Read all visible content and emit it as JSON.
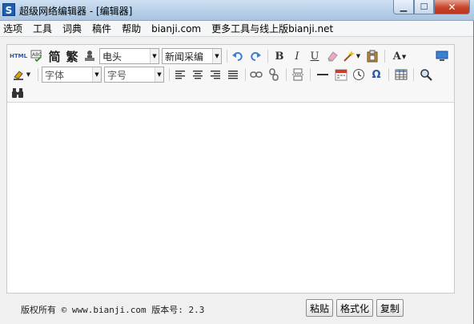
{
  "window": {
    "title": "超级网络编辑器 - [编辑器]",
    "app_icon": "S",
    "minimize": "▁",
    "maximize": "☐",
    "close": "✕"
  },
  "menu": [
    "选项",
    "工具",
    "词典",
    "稿件",
    "帮助",
    "bianji.com",
    "更多工具与线上版bianji.net"
  ],
  "toolbar": {
    "html_label": "HTML",
    "simplified": "简",
    "traditional": "繁",
    "font_head_value": "电头",
    "style_value": "新闻采编",
    "bold": "B",
    "italic": "I",
    "underline": "U",
    "font_family_placeholder": "字体",
    "font_size_placeholder": "字号",
    "omega": "Ω",
    "text_color_label": "A"
  },
  "statusbar": {
    "copyright": "版权所有 © www.bianji.com 版本号: 2.3",
    "paste": "粘贴",
    "format": "格式化",
    "copy": "复制"
  },
  "colors": {
    "titlebar": "#b7cfe8",
    "close_button": "#c7442b",
    "undo_redo": "#3a7fd5"
  }
}
